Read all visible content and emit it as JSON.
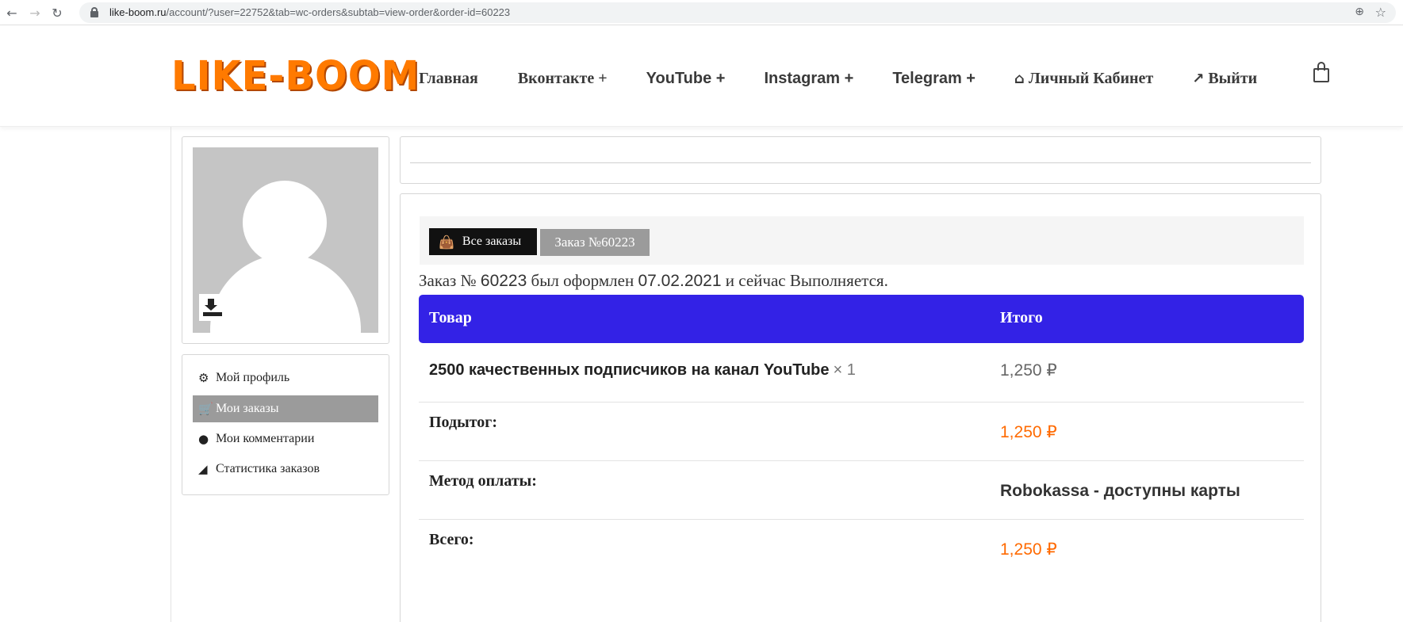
{
  "browser": {
    "url_host": "like-boom.ru",
    "url_path": "/account/?user=22752&tab=wc-orders&subtab=view-order&order-id=60223"
  },
  "header": {
    "logo_text": "LIKE-BOOM",
    "menu": [
      {
        "label": "Главная"
      },
      {
        "label": "Вконтакте +"
      },
      {
        "label": "YouTube +"
      },
      {
        "label": "Instagram +"
      },
      {
        "label": "Telegram +"
      },
      {
        "label": "Личный Кабинет",
        "icon": "home-icon"
      },
      {
        "label": "Выйти",
        "icon": "external-link-icon"
      }
    ],
    "cart_icon": "shopping-bag-icon",
    "accent_color": "#ff7a00"
  },
  "sidebar": {
    "items": [
      {
        "label": "Мой профиль",
        "icon": "gear-icon",
        "active": false
      },
      {
        "label": "Мои заказы",
        "icon": "cart-icon",
        "active": true
      },
      {
        "label": "Мои комментарии",
        "icon": "comment-icon",
        "active": false
      },
      {
        "label": "Статистика заказов",
        "icon": "area-chart-icon",
        "active": false
      }
    ]
  },
  "breadcrumbs": {
    "all_orders": "Все заказы",
    "current": "Заказ №60223"
  },
  "order": {
    "note_prefix": "Заказ №",
    "number": "60223",
    "note_mid": "был оформлен",
    "date": "07.02.2021",
    "note_suffix": "и сейчас Выполняется."
  },
  "table": {
    "header_color": "#3322e6",
    "col_product": "Товар",
    "col_total": "Итого",
    "product_name": "2500 качественных подписчиков на канал YouTube",
    "product_qty": "× 1",
    "product_total": "1,250 ₽",
    "subtotal_label": "Подытог:",
    "subtotal_value": "1,250 ₽",
    "payment_label": "Метод оплаты:",
    "payment_value": "Robokassa - доступны карты",
    "total_label": "Всего:",
    "total_value": "1,250 ₽"
  }
}
